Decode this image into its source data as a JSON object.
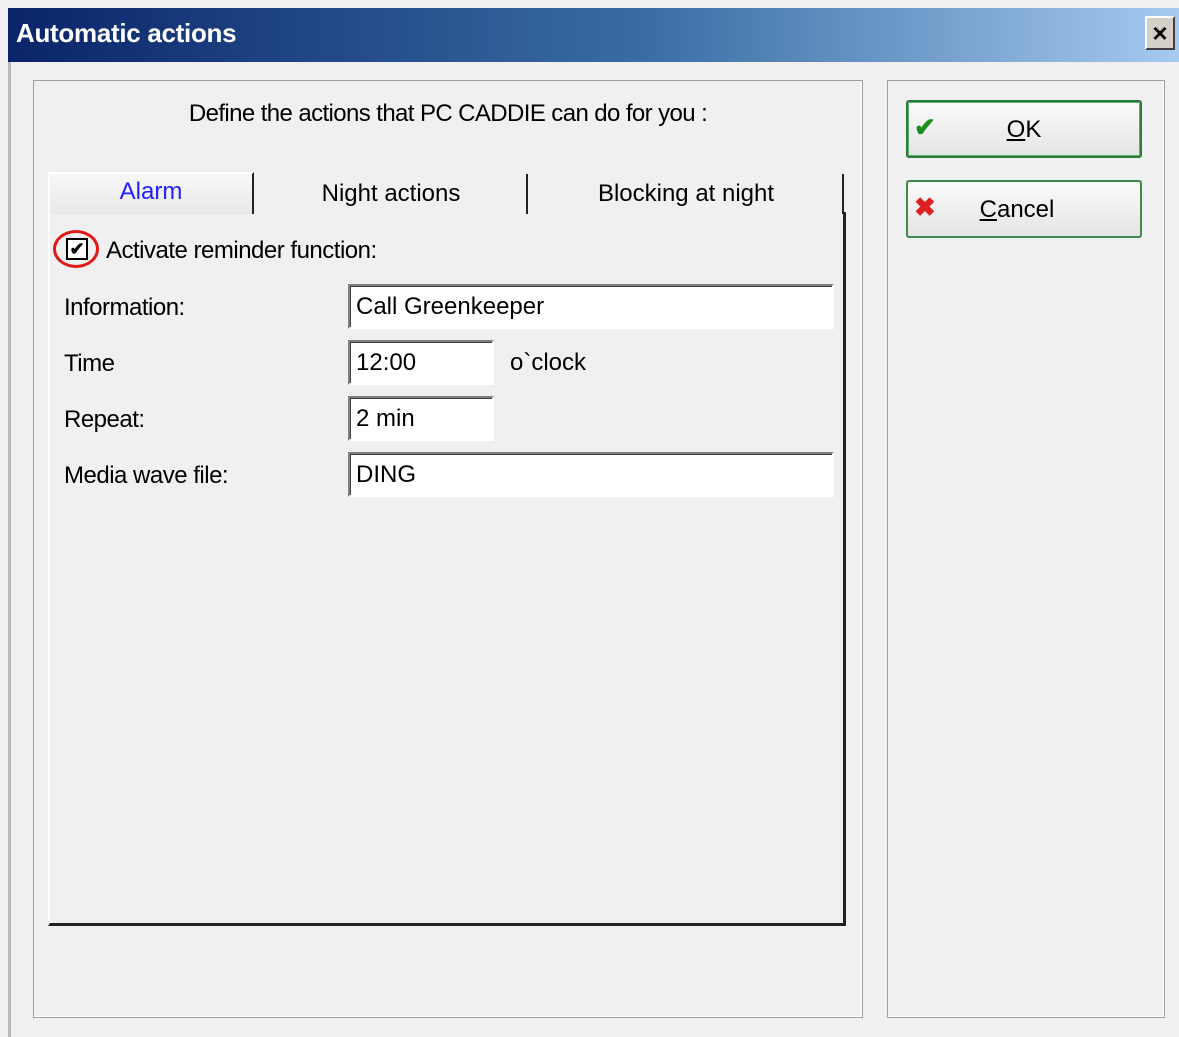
{
  "window": {
    "title": "Automatic actions",
    "close_label": "×"
  },
  "intro_text": "Define the actions that PC CADDIE can do for you :",
  "tabs": [
    {
      "label": "Alarm",
      "active": true
    },
    {
      "label": "Night actions",
      "active": false
    },
    {
      "label": "Blocking at night",
      "active": false
    }
  ],
  "alarm": {
    "activate_label": "Activate reminder function:",
    "activate_checked": true,
    "information_label": "Information:",
    "information_value": "Call Greenkeeper",
    "time_label": "Time",
    "time_value": "12:00",
    "time_unit": "o`clock",
    "repeat_label": "Repeat:",
    "repeat_value": "2 min",
    "media_label": "Media wave file:",
    "media_value": "DING"
  },
  "buttons": {
    "ok_mnemonic": "O",
    "ok_rest": "K",
    "cancel_mnemonic": "C",
    "cancel_rest": "ancel"
  },
  "icons": {
    "ok": "checkmark-icon",
    "cancel": "red-x-icon",
    "checkbox": "check-icon"
  },
  "colors": {
    "active_tab": "#2020ff",
    "highlight_ring": "#e01818",
    "ok_icon": "#1e8c1e",
    "cancel_icon": "#e02020"
  }
}
